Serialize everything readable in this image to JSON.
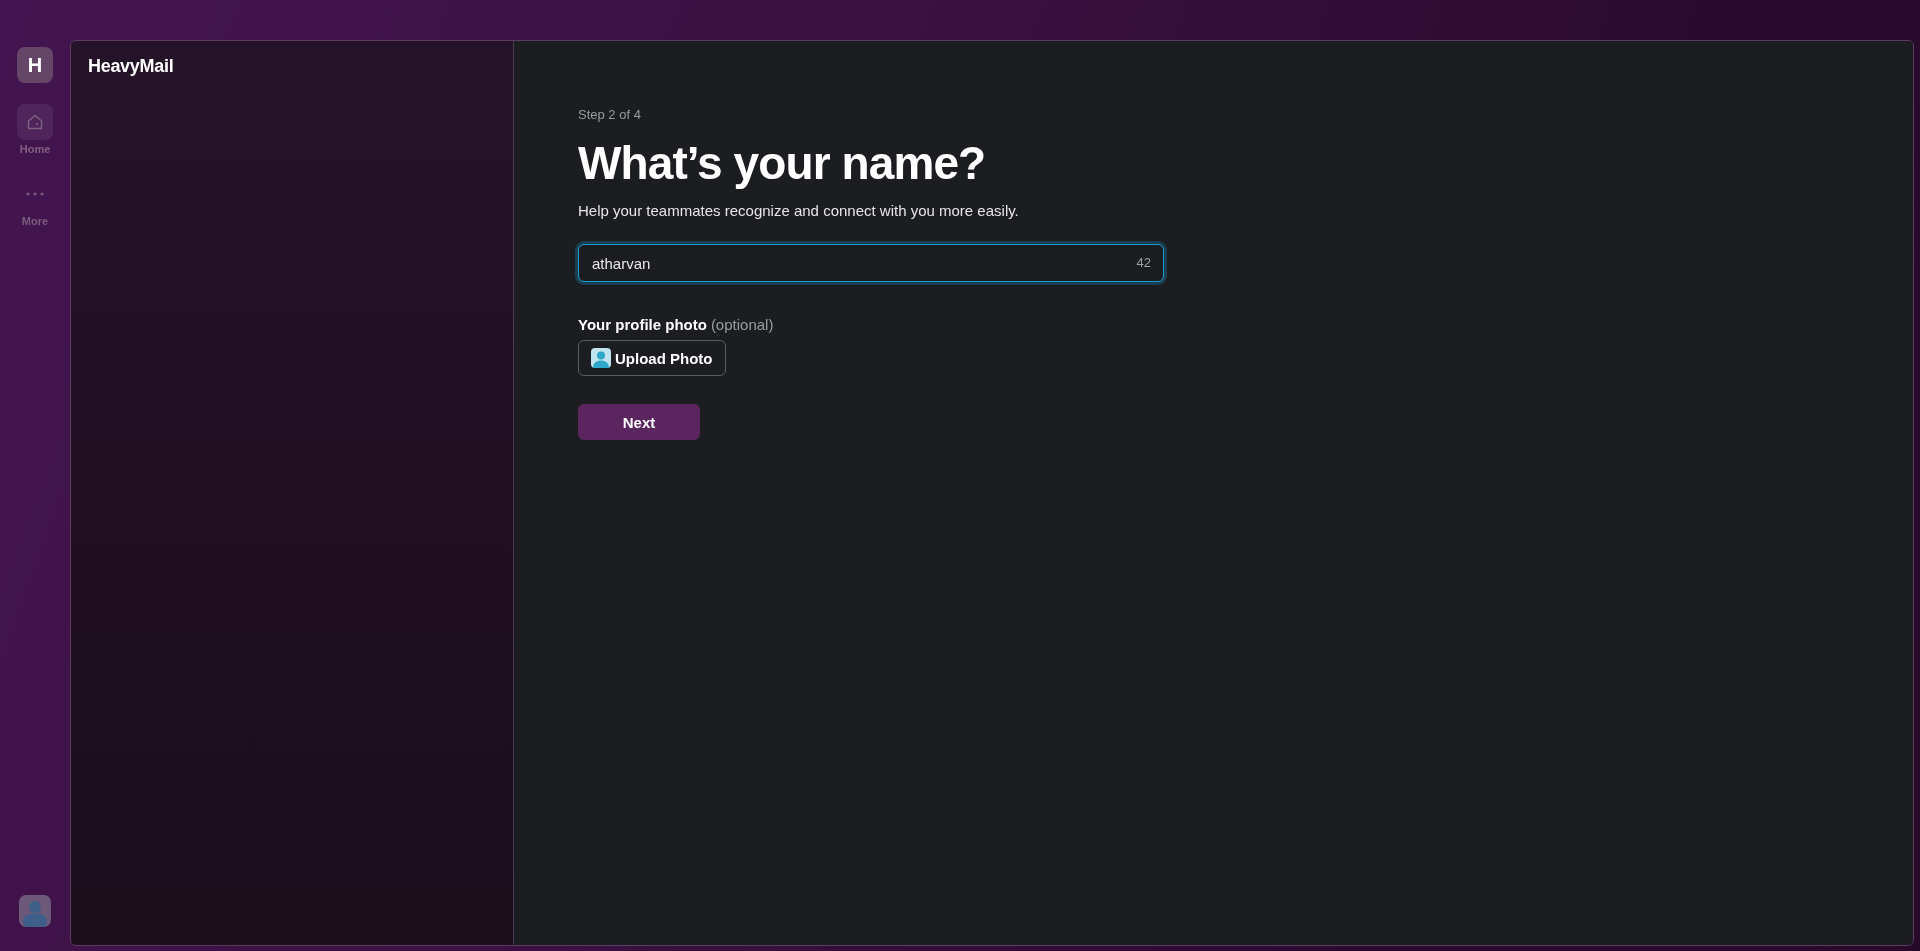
{
  "rail": {
    "workspace": {
      "initial": "H"
    },
    "nav": [
      {
        "kind": "home",
        "label": "Home",
        "selected": true
      },
      {
        "kind": "more",
        "label": "More",
        "selected": false
      }
    ]
  },
  "sidebar": {
    "title": "HeavyMail"
  },
  "form": {
    "step": "Step 2 of 4",
    "heading": "What’s your name?",
    "subtitle": "Help your teammates recognize and connect with you more easily.",
    "name_field": {
      "value": "atharvan",
      "counter": "42",
      "focused": true
    },
    "photo_label": "Your profile photo",
    "photo_hint": "(optional)",
    "upload_button": "Upload Photo",
    "next_button": "Next"
  }
}
